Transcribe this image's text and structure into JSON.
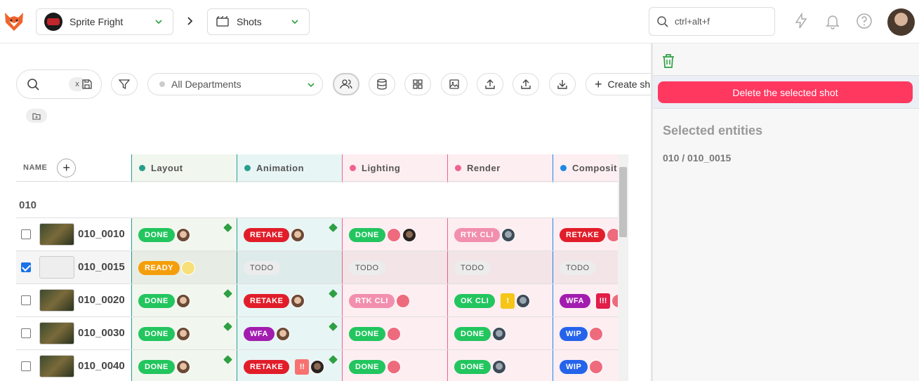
{
  "header": {
    "production": "Sprite Fright",
    "section": "Shots",
    "search_placeholder": "ctrl+alt+f"
  },
  "toolbar": {
    "search_clear": "x",
    "department": "All Departments",
    "create_label": "Create sh"
  },
  "grid": {
    "name_header": "NAME",
    "add_column": "+",
    "columns": [
      {
        "label": "Layout",
        "color": "#2a9d8f",
        "bg": "#f1f7ee"
      },
      {
        "label": "Animation",
        "color": "#2a9d8f",
        "bg": "#e8f5f5"
      },
      {
        "label": "Lighting",
        "color": "#f06292",
        "bg": "#fdeef2"
      },
      {
        "label": "Render",
        "color": "#f06292",
        "bg": "#fdeef2"
      },
      {
        "label": "Composit",
        "color": "#1e88e5",
        "bg": "#fdeef2"
      }
    ],
    "sequence": "010",
    "rows": [
      {
        "name": "010_0010",
        "checked": false,
        "selected": false,
        "empty_thumb": false,
        "cells": [
          {
            "status": "DONE",
            "cls": "b-done",
            "avs": [
              "av-f"
            ],
            "prio": "",
            "cube": true
          },
          {
            "status": "RETAKE",
            "cls": "b-retake",
            "avs": [
              "av-f"
            ],
            "prio": "",
            "cube": true
          },
          {
            "status": "DONE",
            "cls": "b-done",
            "avs": [
              "av-cf",
              "av-m"
            ],
            "prio": "",
            "cube": false
          },
          {
            "status": "RTK CLI",
            "cls": "b-rtk",
            "avs": [
              "av-g"
            ],
            "prio": "",
            "cube": false
          },
          {
            "status": "RETAKE",
            "cls": "b-retake",
            "avs": [
              "av-cf"
            ],
            "prio": "",
            "cube": false
          }
        ]
      },
      {
        "name": "010_0015",
        "checked": true,
        "selected": true,
        "empty_thumb": true,
        "cells": [
          {
            "status": "READY",
            "cls": "b-ready",
            "avs": [
              "av-jf"
            ],
            "prio": "",
            "cube": false
          },
          {
            "status": "TODO",
            "cls": "b-todo",
            "avs": [],
            "prio": "",
            "cube": false
          },
          {
            "status": "TODO",
            "cls": "b-todo",
            "avs": [],
            "prio": "",
            "cube": false
          },
          {
            "status": "TODO",
            "cls": "b-todo",
            "avs": [],
            "prio": "",
            "cube": false
          },
          {
            "status": "TODO",
            "cls": "b-todo",
            "avs": [],
            "prio": "",
            "cube": false
          }
        ]
      },
      {
        "name": "010_0020",
        "checked": false,
        "selected": false,
        "empty_thumb": false,
        "cells": [
          {
            "status": "DONE",
            "cls": "b-done",
            "avs": [
              "av-f"
            ],
            "prio": "",
            "cube": true
          },
          {
            "status": "RETAKE",
            "cls": "b-retake",
            "avs": [
              "av-f"
            ],
            "prio": "",
            "cube": true
          },
          {
            "status": "RTK CLI",
            "cls": "b-rtk",
            "avs": [
              "av-cf"
            ],
            "prio": "",
            "cube": false
          },
          {
            "status": "OK CLI",
            "cls": "b-okcli",
            "avs": [
              "av-g"
            ],
            "prio": "!",
            "prio_cls": "y",
            "cube": false
          },
          {
            "status": "WFA",
            "cls": "b-wfa",
            "avs": [
              "av-cf"
            ],
            "prio": "!!!",
            "prio_cls": "r",
            "cube": false
          }
        ]
      },
      {
        "name": "010_0030",
        "checked": false,
        "selected": false,
        "empty_thumb": false,
        "cells": [
          {
            "status": "DONE",
            "cls": "b-done",
            "avs": [
              "av-f"
            ],
            "prio": "",
            "cube": true
          },
          {
            "status": "WFA",
            "cls": "b-wfa",
            "avs": [
              "av-f"
            ],
            "prio": "",
            "cube": true
          },
          {
            "status": "DONE",
            "cls": "b-done",
            "avs": [
              "av-cf"
            ],
            "prio": "",
            "cube": false
          },
          {
            "status": "DONE",
            "cls": "b-done",
            "avs": [
              "av-g"
            ],
            "prio": "",
            "cube": false
          },
          {
            "status": "WIP",
            "cls": "b-wip",
            "avs": [
              "av-cf"
            ],
            "prio": "",
            "cube": false
          }
        ]
      },
      {
        "name": "010_0040",
        "checked": false,
        "selected": false,
        "empty_thumb": false,
        "cells": [
          {
            "status": "DONE",
            "cls": "b-done",
            "avs": [
              "av-f"
            ],
            "prio": "",
            "cube": true
          },
          {
            "status": "RETAKE",
            "cls": "b-retake",
            "avs": [
              "av-m"
            ],
            "prio": "!!",
            "prio_cls": "o",
            "cube": true
          },
          {
            "status": "DONE",
            "cls": "b-done",
            "avs": [
              "av-cf"
            ],
            "prio": "",
            "cube": false
          },
          {
            "status": "DONE",
            "cls": "b-done",
            "avs": [
              "av-g"
            ],
            "prio": "",
            "cube": false
          },
          {
            "status": "WIP",
            "cls": "b-wip",
            "avs": [
              "av-cf"
            ],
            "prio": "",
            "cube": false
          }
        ]
      }
    ]
  },
  "panel": {
    "delete_label": "Delete the selected shot",
    "title": "Selected entities",
    "entity": "010 / 010_0015"
  },
  "colors": {
    "danger": "#ff3860",
    "done": "#22c55e",
    "retake": "#e11d2a"
  }
}
